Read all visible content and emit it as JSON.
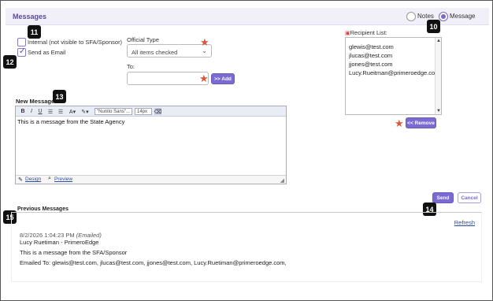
{
  "header": {
    "title": "Messages",
    "radio_notes": "Notes",
    "radio_message": "Message",
    "selected": "Message"
  },
  "badges": [
    "10",
    "11",
    "12",
    "13",
    "14",
    "15"
  ],
  "options": {
    "internal_label": "Internal (not visible to SFA/Sponsor)",
    "internal_checked": false,
    "send_email_label": "Send as Email",
    "send_email_checked": true
  },
  "official_type": {
    "label": "Official Type",
    "value": "All items checked"
  },
  "to": {
    "label": "To:",
    "value": "",
    "add_button": ">> Add"
  },
  "recipients": {
    "label": "Recipient List:",
    "items": [
      "glewis@test.com",
      "jlucas@test.com",
      "jjones@test.com",
      "Lucy.Rueitman@primeroedge.com"
    ],
    "remove_button": "<< Remove"
  },
  "editor": {
    "label": "New Message",
    "font": "\"Nunito Sans\"...",
    "size": "14px",
    "content": "This is a message from the State Agency",
    "tab_design": "Design",
    "tab_preview": "Preview"
  },
  "actions": {
    "send": "Send",
    "cancel": "Cancel"
  },
  "previous": {
    "title": "Previous Messages",
    "refresh": "Refresh",
    "timestamp": "8/2/2026 1:04:23 PM",
    "status": "(Emailed)",
    "author": "Lucy Ruetiman - PrimeroEdge",
    "body": "This is a message from the SFA/Sponsor",
    "emailed_to": "Emailed To: glewis@test.com, jlucas@test.com, jjones@test.com, Lucy.Ruetiman@primeroedge.com,"
  },
  "colors": {
    "accent": "#7b6ad1",
    "required_star": "#d9573b",
    "header_bg": "#f1eff8"
  }
}
